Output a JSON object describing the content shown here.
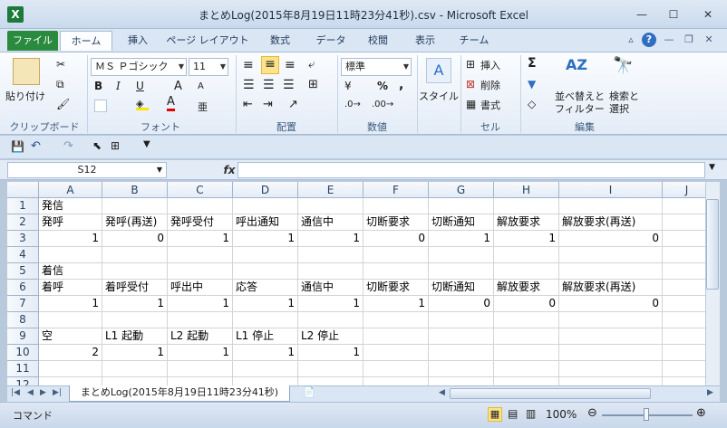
{
  "window": {
    "title": "まとめLog(2015年8月19日11時23分41秒).csv - Microsoft Excel",
    "app_icon": "X",
    "minimize": "—",
    "maximize": "☐",
    "close": "✕"
  },
  "ribbon_tabs": [
    "ファイル",
    "ホーム",
    "挿入",
    "ページ レイアウト",
    "数式",
    "データ",
    "校閲",
    "表示",
    "チーム"
  ],
  "ribbon": {
    "clipboard": {
      "paste": "貼り付け",
      "label": "クリップボード"
    },
    "font": {
      "name": "ＭＳ Ｐゴシック",
      "size": "11",
      "bold": "B",
      "italic": "I",
      "underline": "U",
      "grow": "A",
      "shrink": "A",
      "color_a": "A",
      "label": "フォント"
    },
    "alignment": {
      "label": "配置"
    },
    "number": {
      "format": "標準",
      "percent": "%",
      "comma": ",",
      "label": "数値"
    },
    "styles": {
      "label": "スタイル"
    },
    "cells": {
      "insert": "挿入",
      "delete": "削除",
      "format": "書式",
      "label": "セル"
    },
    "editing": {
      "sort": "並べ替えと\nフィルター",
      "sort_l1": "並べ替えと",
      "sort_l2": "フィルター",
      "find_l1": "検索と",
      "find_l2": "選択",
      "label": "編集"
    }
  },
  "formula_bar": {
    "name_box": "S12",
    "fx": "fx",
    "value": ""
  },
  "columns": [
    "A",
    "B",
    "C",
    "D",
    "E",
    "F",
    "G",
    "H",
    "I",
    "J"
  ],
  "rows": [
    {
      "num": "1",
      "cells": [
        "発信",
        "",
        "",
        "",
        "",
        "",
        "",
        "",
        "",
        ""
      ]
    },
    {
      "num": "2",
      "cells": [
        "発呼",
        "発呼(再送)",
        "発呼受付",
        "呼出通知",
        "通信中",
        "切断要求",
        "切断通知",
        "解放要求",
        "解放要求(再送)",
        ""
      ]
    },
    {
      "num": "3",
      "cells": [
        "1",
        "0",
        "1",
        "1",
        "1",
        "0",
        "1",
        "1",
        "0",
        ""
      ]
    },
    {
      "num": "4",
      "cells": [
        "",
        "",
        "",
        "",
        "",
        "",
        "",
        "",
        "",
        ""
      ]
    },
    {
      "num": "5",
      "cells": [
        "着信",
        "",
        "",
        "",
        "",
        "",
        "",
        "",
        "",
        ""
      ]
    },
    {
      "num": "6",
      "cells": [
        "着呼",
        "着呼受付",
        "呼出中",
        "応答",
        "通信中",
        "切断要求",
        "切断通知",
        "解放要求",
        "解放要求(再送)",
        ""
      ]
    },
    {
      "num": "7",
      "cells": [
        "1",
        "1",
        "1",
        "1",
        "1",
        "1",
        "0",
        "0",
        "0",
        ""
      ]
    },
    {
      "num": "8",
      "cells": [
        "",
        "",
        "",
        "",
        "",
        "",
        "",
        "",
        "",
        ""
      ]
    },
    {
      "num": "9",
      "cells": [
        "空",
        "L1 起動",
        "L2 起動",
        "L1 停止",
        "L2 停止",
        "",
        "",
        "",
        "",
        ""
      ]
    },
    {
      "num": "10",
      "cells": [
        "2",
        "1",
        "1",
        "1",
        "1",
        "",
        "",
        "",
        "",
        ""
      ]
    },
    {
      "num": "11",
      "cells": [
        "",
        "",
        "",
        "",
        "",
        "",
        "",
        "",
        "",
        ""
      ]
    },
    {
      "num": "12",
      "cells": [
        "",
        "",
        "",
        "",
        "",
        "",
        "",
        "",
        "",
        ""
      ]
    }
  ],
  "sheet_tab": "まとめLog(2015年8月19日11時23分41秒)",
  "status": {
    "mode": "コマンド",
    "zoom": "100%"
  }
}
